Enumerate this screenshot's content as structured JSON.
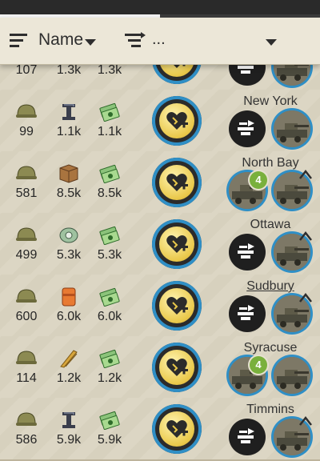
{
  "header": {
    "sort_label": "Name",
    "filter_label": "..."
  },
  "rows": [
    {
      "infantry": "107",
      "res2": "1.3k",
      "money": "1.3k",
      "city": "",
      "res2_type": "mixed",
      "units": [
        "dark",
        "photo"
      ],
      "badge": null,
      "upgrade": true
    },
    {
      "infantry": "99",
      "res2": "1.1k",
      "money": "1.1k",
      "city": "New York",
      "res2_type": "steel",
      "units": [
        "dark",
        "photo"
      ],
      "badge": null,
      "upgrade": false
    },
    {
      "infantry": "581",
      "res2": "8.5k",
      "money": "8.5k",
      "city": "North Bay",
      "res2_type": "crate",
      "units": [
        "photo",
        "photo"
      ],
      "badge": "4",
      "upgrade": true
    },
    {
      "infantry": "499",
      "res2": "5.3k",
      "money": "5.3k",
      "city": "Ottawa",
      "res2_type": "parts",
      "units": [
        "dark",
        "photo"
      ],
      "badge": null,
      "upgrade": true
    },
    {
      "infantry": "600",
      "res2": "6.0k",
      "money": "6.0k",
      "city": "Sudbury",
      "res2_type": "oil",
      "units": [
        "dark",
        "photo"
      ],
      "badge": null,
      "upgrade": true
    },
    {
      "infantry": "114",
      "res2": "1.2k",
      "money": "1.2k",
      "city": "Syracuse",
      "res2_type": "food",
      "units": [
        "photo",
        "photo"
      ],
      "badge": "4",
      "upgrade": false
    },
    {
      "infantry": "586",
      "res2": "5.9k",
      "money": "5.9k",
      "city": "Timmins",
      "res2_type": "steel",
      "units": [
        "dark",
        "photo"
      ],
      "badge": null,
      "upgrade": true
    }
  ],
  "colors": {
    "accent": "#2f8fc6",
    "badge": "#79b03c",
    "coin": "#e9c84a"
  },
  "icons": {
    "sort": "sort-lines-icon",
    "filter": "filter-icon",
    "heal": "heart-plus-icon",
    "unit_cmd": "command-unit-icon"
  }
}
